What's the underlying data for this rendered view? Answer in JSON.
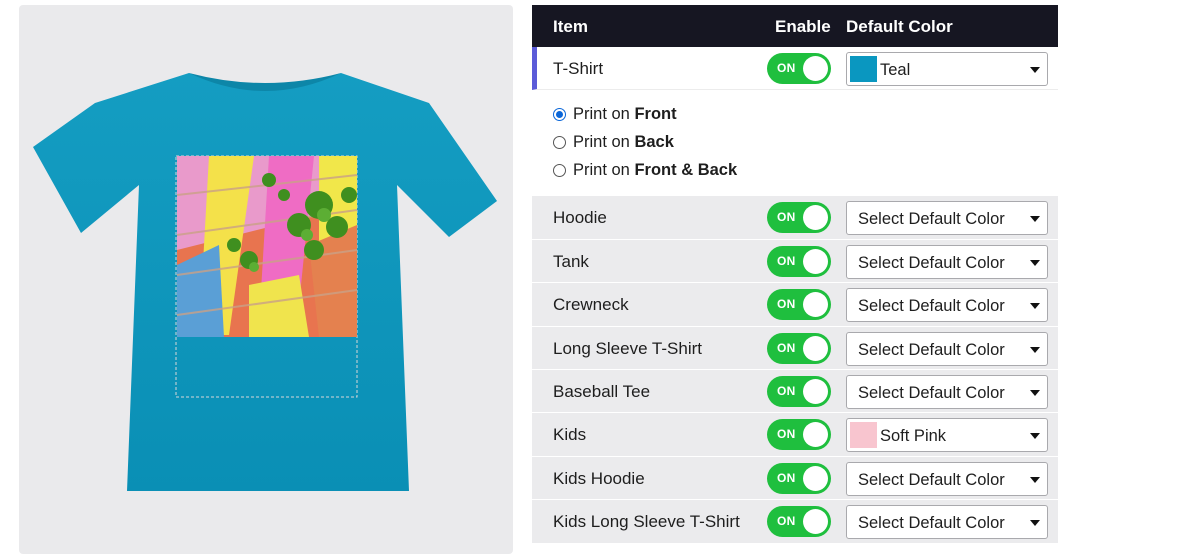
{
  "header": {
    "item": "Item",
    "enable": "Enable",
    "default_color": "Default Color"
  },
  "colors": {
    "tshirt": "#0f98bd",
    "teal": "#0a97c0",
    "soft_pink": "#f8c5cf",
    "toggle_on": "#1fbf3e",
    "selected_bar": "#5b5bd8"
  },
  "tshirt_row": {
    "label": "T-Shirt",
    "toggle": "ON",
    "color_label": "Teal"
  },
  "print_options": [
    {
      "prefix": "Print on ",
      "bold": "Front",
      "checked": true
    },
    {
      "prefix": "Print on ",
      "bold": "Back",
      "checked": false
    },
    {
      "prefix": "Print on ",
      "bold": "Front & Back",
      "checked": false
    }
  ],
  "rows": [
    {
      "label": "Hoodie",
      "toggle": "ON",
      "color_label": "Select Default Color"
    },
    {
      "label": "Tank",
      "toggle": "ON",
      "color_label": "Select Default Color"
    },
    {
      "label": "Crewneck",
      "toggle": "ON",
      "color_label": "Select Default Color"
    },
    {
      "label": "Long Sleeve T-Shirt",
      "toggle": "ON",
      "color_label": "Select Default Color"
    },
    {
      "label": "Baseball Tee",
      "toggle": "ON",
      "color_label": "Select Default Color"
    },
    {
      "label": "Kids",
      "toggle": "ON",
      "color_label": "Soft Pink"
    },
    {
      "label": "Kids Hoodie",
      "toggle": "ON",
      "color_label": "Select Default Color"
    },
    {
      "label": "Kids Long Sleeve T-Shirt",
      "toggle": "ON",
      "color_label": "Select Default Color"
    }
  ]
}
